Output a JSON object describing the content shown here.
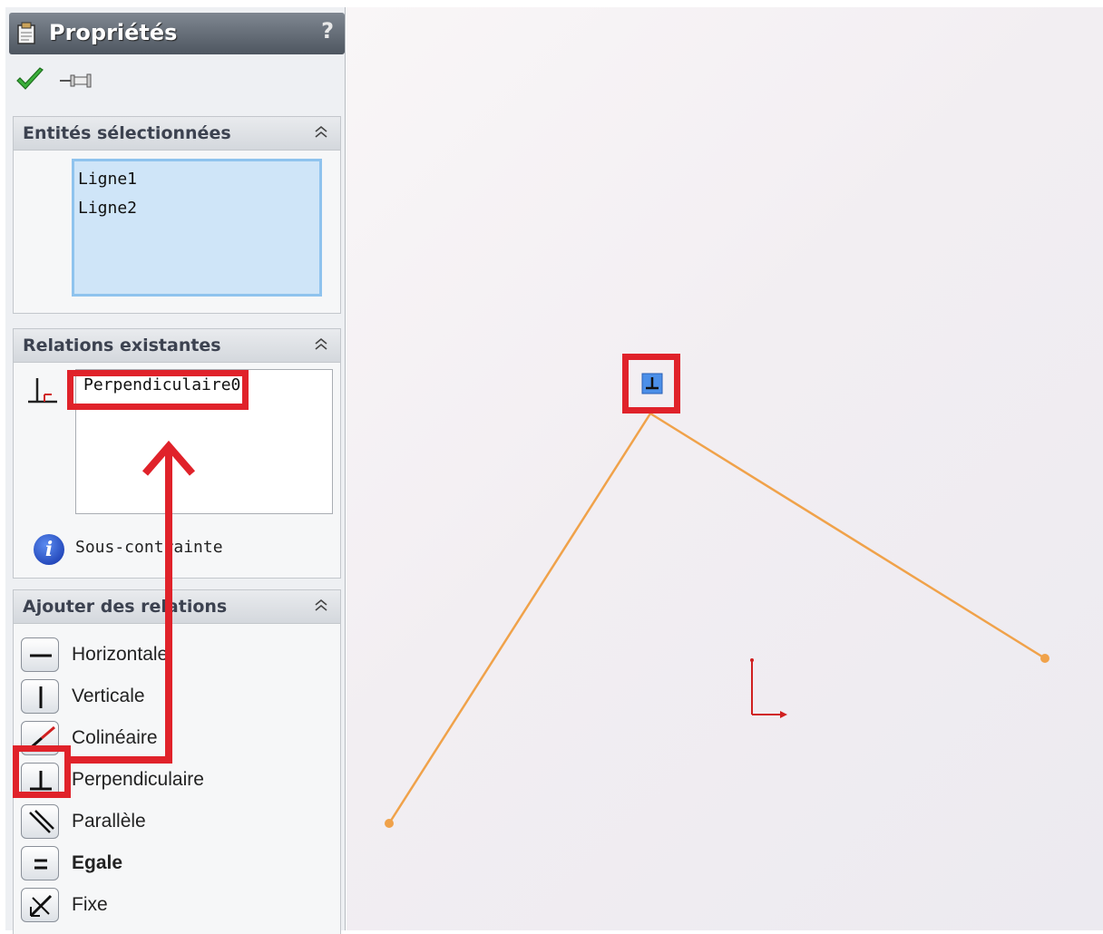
{
  "panel": {
    "title": "Propriétés",
    "help": "?"
  },
  "selected_entities": {
    "header": "Entités sélectionnées",
    "items": [
      "Ligne1",
      "Ligne2"
    ]
  },
  "existing_relations": {
    "header": "Relations existantes",
    "items": [
      "Perpendiculaire0"
    ],
    "status": "Sous-contrainte"
  },
  "add_relations": {
    "header": "Ajouter des relations",
    "items": [
      {
        "label": "Horizontale",
        "icon": "horizontal-icon"
      },
      {
        "label": "Verticale",
        "icon": "vertical-icon"
      },
      {
        "label": "Colinéaire",
        "icon": "collinear-icon"
      },
      {
        "label": "Perpendiculaire",
        "icon": "perpendicular-icon"
      },
      {
        "label": "Parallèle",
        "icon": "parallel-icon"
      },
      {
        "label": "Egale",
        "icon": "equal-icon"
      },
      {
        "label": "Fixe",
        "icon": "fix-icon"
      }
    ]
  },
  "colors": {
    "sketch_line": "#f0a24a",
    "highlight": "#e0222a",
    "selection_fill": "#cfe5f8",
    "origin": "#d02020"
  }
}
